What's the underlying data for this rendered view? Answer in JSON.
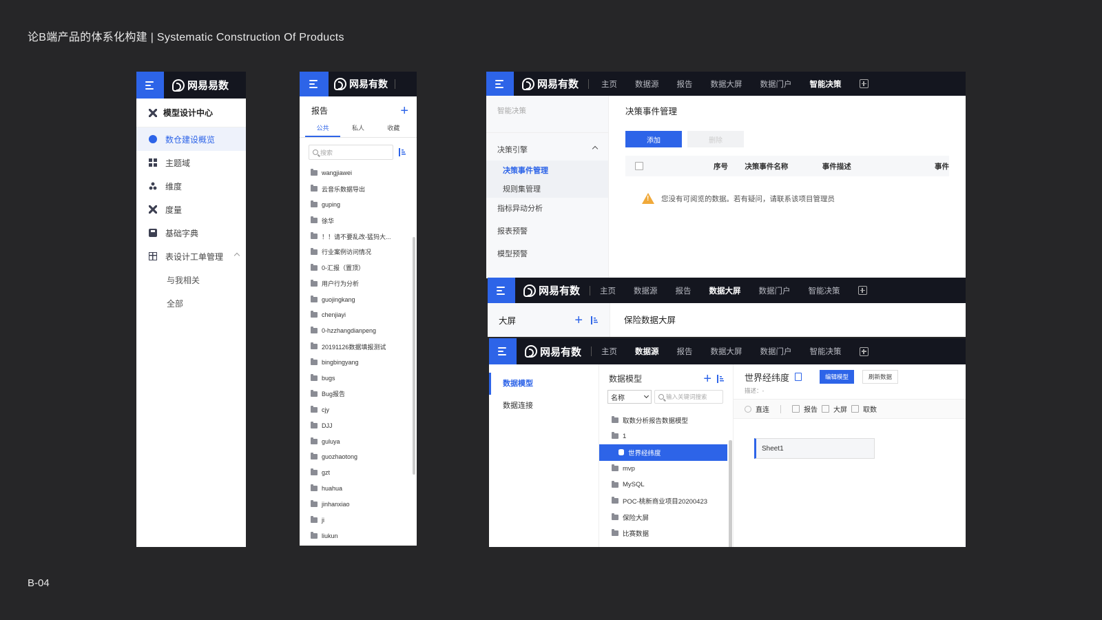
{
  "page": {
    "title": "论B端产品的体系化构建 | Systematic Construction Of Products",
    "code": "B-04"
  },
  "brand": {
    "name_p1": "网易易数",
    "name": "网易有数",
    "accent": "#2d64e8"
  },
  "p1": {
    "heading": "模型设计中心",
    "items": [
      {
        "label": "数仓建设概览",
        "icon": "dashboard-icon"
      },
      {
        "label": "主题域",
        "icon": "grid-icon"
      },
      {
        "label": "维度",
        "icon": "tree-icon"
      },
      {
        "label": "度量",
        "icon": "tool-icon"
      },
      {
        "label": "基础字典",
        "icon": "save-icon"
      },
      {
        "label": "表设计工单管理",
        "icon": "table-icon"
      }
    ],
    "subitems": [
      "与我相关",
      "全部"
    ]
  },
  "p2": {
    "title": "报告",
    "tabs": [
      "公共",
      "私人",
      "收藏"
    ],
    "search_placeholder": "搜索",
    "folders": [
      "wangjiawei",
      "云音乐数据导出",
      "guping",
      "徐华",
      "！！请不要乱改-猛犸大...",
      "行业案例访问情况",
      "0-汇报（置顶）",
      "用户行为分析",
      "guojingkang",
      "chenjiayi",
      "0-hzzhangdianpeng",
      "20191126数据填报测试",
      "bingbingyang",
      "bugs",
      "Bug报告",
      "cjy",
      "DJJ",
      "guluya",
      "guozhaotong",
      "gzt",
      "huahua",
      "jinhanxiao",
      "ji",
      "liukun"
    ]
  },
  "p3": {
    "nav": [
      "主页",
      "数据源",
      "报告",
      "数据大屏",
      "数据门户",
      "智能决策"
    ],
    "crumb": "智能决策",
    "group": "决策引擎",
    "subs": [
      "决策事件管理",
      "规则集管理"
    ],
    "items": [
      "指标异动分析",
      "报表预警",
      "模型预警"
    ],
    "main_title": "决策事件管理",
    "btn_add": "添加",
    "btn_del": "删除",
    "cols": [
      "序号",
      "决策事件名称",
      "事件描述",
      "事件"
    ],
    "warning": "您没有可阅览的数据。若有疑问，请联系该项目管理员"
  },
  "p4": {
    "side_title": "大屏",
    "main_title": "保险数据大屏"
  },
  "p5": {
    "left": [
      "数据模型",
      "数据连接"
    ],
    "mid_title": "数据模型",
    "select": "名称",
    "search_placeholder": "输入关键词搜索",
    "tree": [
      "取数分析报告数据模型",
      "1",
      "世界经纬度",
      "mvp",
      "MySQL",
      "POC-桃新商业项目20200423",
      "保险大屏",
      "比赛数据"
    ],
    "right_title": "世界经纬度",
    "btn_edit": "编辑模型",
    "btn_refresh": "刷新数据",
    "desc": "描述：-",
    "opts": [
      "直连",
      "报告",
      "大屏",
      "取数"
    ],
    "sheet": "Sheet1"
  }
}
